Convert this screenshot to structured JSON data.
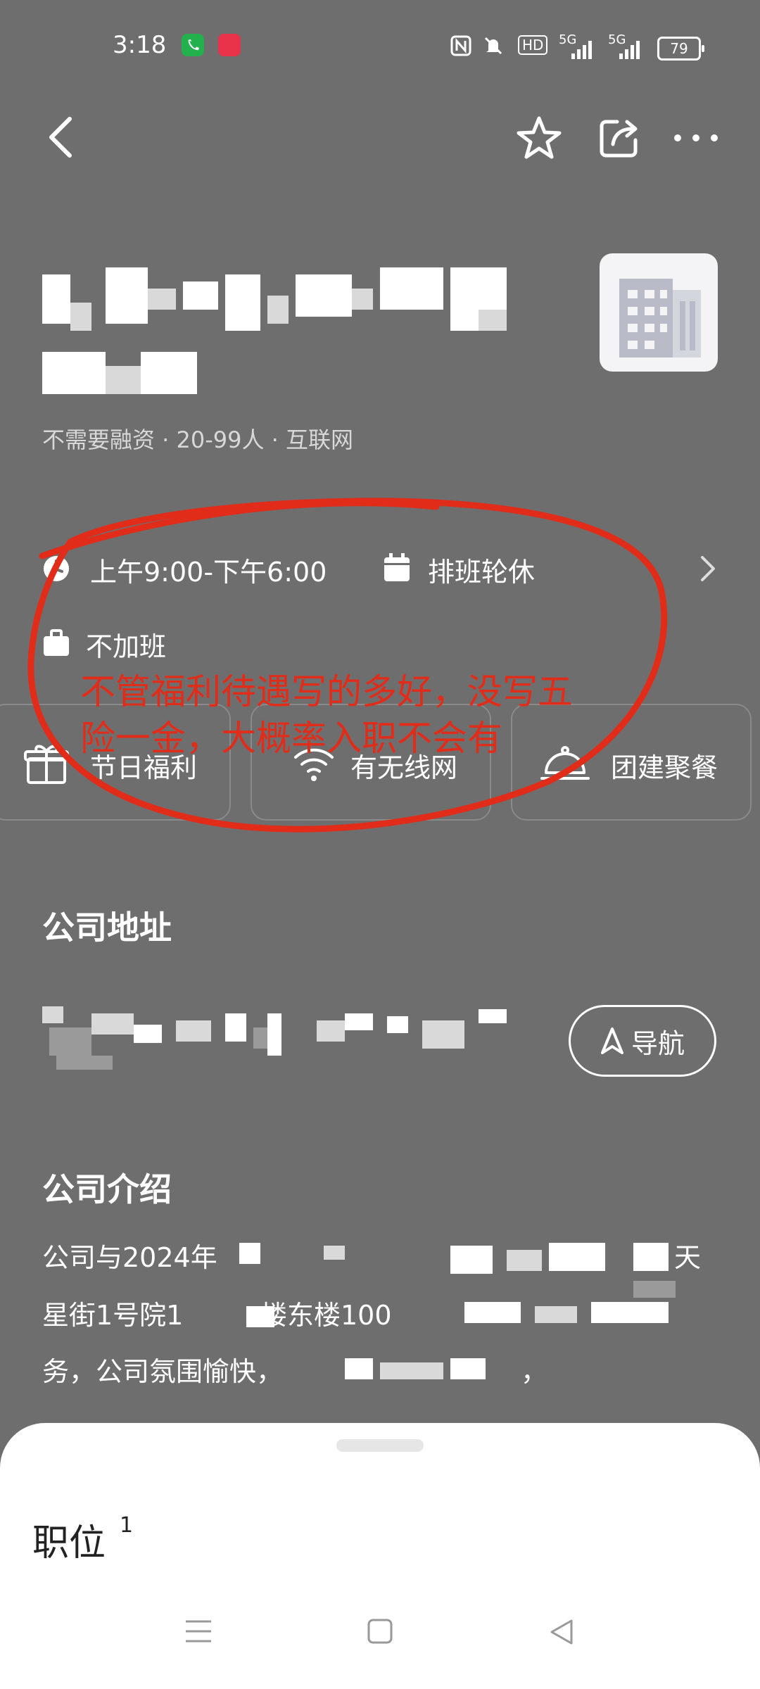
{
  "status_bar": {
    "time": "3:18",
    "hd_label": "HD",
    "signal_1": "5G",
    "signal_2": "5G",
    "battery": "79",
    "accent_call": "#22b14c",
    "accent_app": "#e8334a"
  },
  "company": {
    "meta": "不需要融资 · 20-99人 · 互联网"
  },
  "work_info": {
    "hours": "上午9:00-下午6:00",
    "schedule": "排班轮休",
    "overtime": "不加班"
  },
  "benefits": [
    {
      "label": "节日福利",
      "icon": "gift-icon"
    },
    {
      "label": "有无线网",
      "icon": "wifi-icon"
    },
    {
      "label": "团建聚餐",
      "icon": "food-cover-icon"
    }
  ],
  "address": {
    "title": "公司地址",
    "nav_label": "导航"
  },
  "intro": {
    "title": "公司介绍",
    "line1": "公司与2024年",
    "line1_end": "天",
    "line2": "星街1号院1",
    "line2_mid": "楼东楼100",
    "line3": "务，公司氛围愉快，",
    "line3_end": "，"
  },
  "annotation": {
    "text": "不管福利待遇写的多好，没写五险一金，大概率入职不会有",
    "color": "#e22c1a"
  },
  "sheet": {
    "title": "职位",
    "count": "1"
  }
}
